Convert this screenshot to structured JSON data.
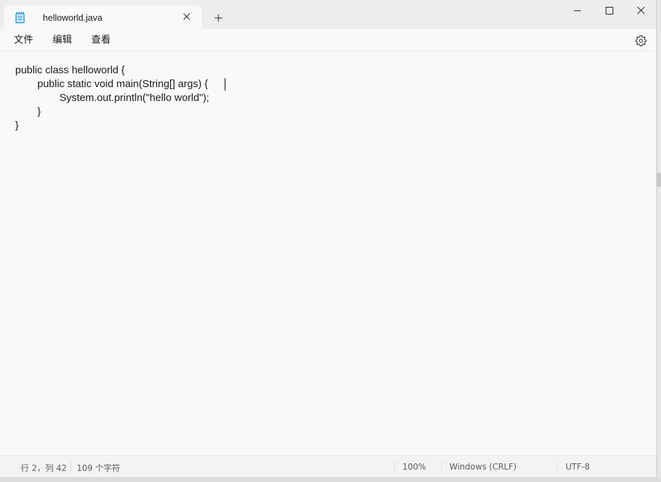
{
  "tab": {
    "title": "helloworld.java",
    "app_icon": "notepad-icon",
    "close_icon": "close-icon",
    "new_tab_icon": "plus-icon"
  },
  "window_controls": {
    "minimize_icon": "minimize-icon",
    "maximize_icon": "maximize-icon",
    "close_icon": "close-icon"
  },
  "menu": {
    "file": "文件",
    "edit": "编辑",
    "view": "查看",
    "settings_icon": "gear-icon"
  },
  "editor": {
    "lines": [
      "public class helloworld {",
      "public static void main(String[] args) {",
      "System.out.println(\"hello world\");",
      "}",
      "}"
    ]
  },
  "status": {
    "position": "行 2，列 42",
    "char_count": "109 个字符",
    "zoom": "100%",
    "line_ending": "Windows (CRLF)",
    "encoding": "UTF-8"
  },
  "colors": {
    "background": "#f9f9f9",
    "titlebar": "#ededed",
    "text": "#1a1a1a",
    "notepad_icon": "#2b9bd8"
  }
}
